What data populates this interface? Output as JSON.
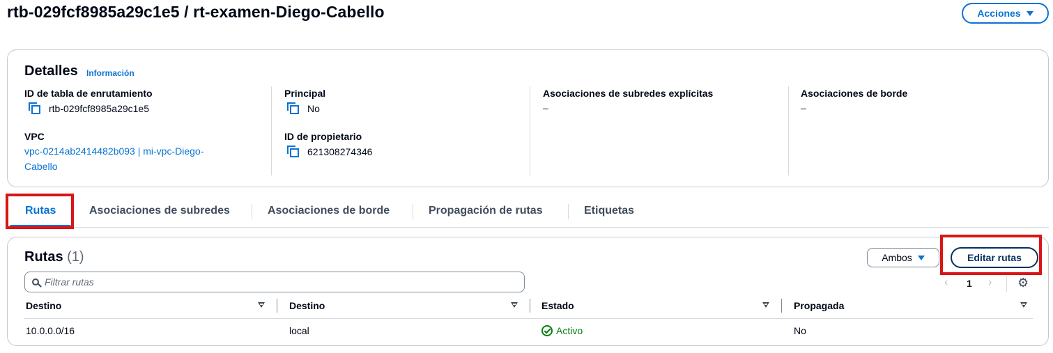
{
  "header": {
    "title": "rtb-029fcf8985a29c1e5 / rt-examen-Diego-Cabello",
    "actions_label": "Acciones"
  },
  "details": {
    "title": "Detalles",
    "info_link": "Información",
    "route_table_id_label": "ID de tabla de enrutamiento",
    "route_table_id_value": "rtb-029fcf8985a29c1e5",
    "vpc_label": "VPC",
    "vpc_value_line1": "vpc-0214ab2414482b093 | mi-vpc-Diego-",
    "vpc_value_line2": "Cabello",
    "main_label": "Principal",
    "main_value": "No",
    "owner_id_label": "ID de propietario",
    "owner_id_value": "621308274346",
    "explicit_subnet_assoc_label": "Asociaciones de subredes explícitas",
    "explicit_subnet_assoc_value": "–",
    "edge_assoc_label": "Asociaciones de borde",
    "edge_assoc_value": "–"
  },
  "tabs": [
    {
      "label": "Rutas",
      "active": true
    },
    {
      "label": "Asociaciones de subredes",
      "active": false
    },
    {
      "label": "Asociaciones de borde",
      "active": false
    },
    {
      "label": "Propagación de rutas",
      "active": false
    },
    {
      "label": "Etiquetas",
      "active": false
    }
  ],
  "routes": {
    "title": "Rutas",
    "count": "(1)",
    "filter_select_value": "Ambos",
    "edit_button_label": "Editar rutas",
    "search_placeholder": "Filtrar rutas",
    "page_number": "1",
    "columns": [
      "Destino",
      "Destino",
      "Estado",
      "Propagada"
    ],
    "rows": [
      {
        "destination": "10.0.0.0/16",
        "target": "local",
        "status": "Activo",
        "propagated": "No"
      }
    ]
  },
  "icons": {
    "copy": "copy-icon",
    "search": "search-icon",
    "settings": "gear-icon",
    "status_ok": "check-circle-icon",
    "sort": "sort-caret-icon"
  },
  "colors": {
    "accent": "#0972d3",
    "success": "#037f0c",
    "highlight": "#d91515"
  }
}
